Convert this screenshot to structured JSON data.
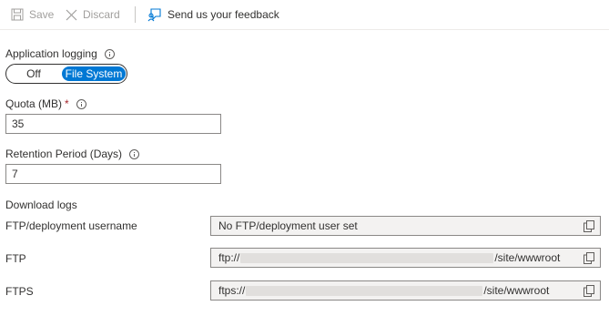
{
  "toolbar": {
    "save_label": "Save",
    "discard_label": "Discard",
    "feedback_label": "Send us your feedback"
  },
  "app_logging": {
    "label": "Application logging",
    "options": [
      "Off",
      "File System"
    ],
    "selected": "File System"
  },
  "quota": {
    "label": "Quota (MB)",
    "required_mark": "*",
    "value": "35"
  },
  "retention": {
    "label": "Retention Period (Days)",
    "value": "7"
  },
  "download": {
    "title": "Download logs",
    "username_label": "FTP/deployment username",
    "username_value": "No FTP/deployment user set",
    "ftp_label": "FTP",
    "ftp_prefix": "ftp://",
    "ftp_suffix": "/site/wwwroot",
    "ftps_label": "FTPS",
    "ftps_prefix": "ftps://",
    "ftps_suffix": "/site/wwwroot"
  },
  "colors": {
    "accent": "#0078d4",
    "required": "#a4262c",
    "disabled": "#a19f9d"
  }
}
